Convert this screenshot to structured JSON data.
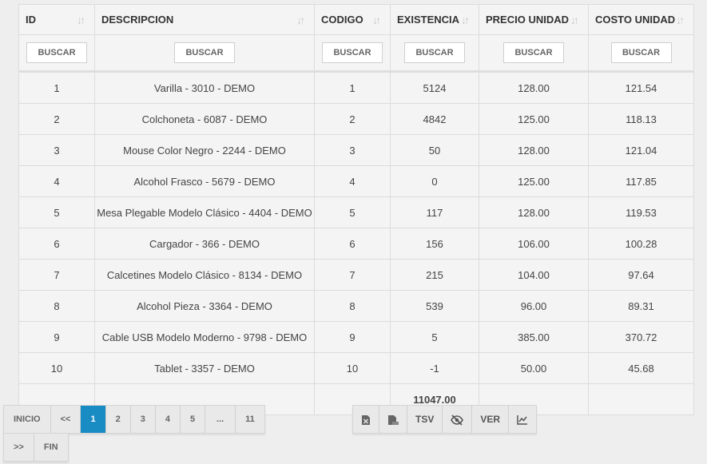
{
  "table": {
    "columns": [
      {
        "key": "id",
        "label": "ID",
        "search_placeholder": "BUSCAR"
      },
      {
        "key": "descripcion",
        "label": "DESCRIPCION",
        "search_placeholder": "BUSCAR"
      },
      {
        "key": "codigo",
        "label": "CODIGO",
        "search_placeholder": "BUSCAR"
      },
      {
        "key": "existencia",
        "label": "EXISTENCIA",
        "search_placeholder": "BUSCAR"
      },
      {
        "key": "precio",
        "label": "PRECIO UNIDAD",
        "search_placeholder": "BUSCAR"
      },
      {
        "key": "costo",
        "label": "COSTO UNIDAD",
        "search_placeholder": "BUSCAR"
      }
    ],
    "rows": [
      [
        "1",
        "Varilla - 3010 - DEMO",
        "1",
        "5124",
        "128.00",
        "121.54"
      ],
      [
        "2",
        "Colchoneta - 6087 - DEMO",
        "2",
        "4842",
        "125.00",
        "118.13"
      ],
      [
        "3",
        "Mouse Color Negro - 2244 - DEMO",
        "3",
        "50",
        "128.00",
        "121.04"
      ],
      [
        "4",
        "Alcohol Frasco - 5679 - DEMO",
        "4",
        "0",
        "125.00",
        "117.85"
      ],
      [
        "5",
        "Mesa Plegable Modelo Clásico - 4404 - DEMO",
        "5",
        "117",
        "128.00",
        "119.53"
      ],
      [
        "6",
        "Cargador - 366 - DEMO",
        "6",
        "156",
        "106.00",
        "100.28"
      ],
      [
        "7",
        "Calcetines Modelo Clásico - 8134 - DEMO",
        "7",
        "215",
        "104.00",
        "97.64"
      ],
      [
        "8",
        "Alcohol Pieza - 3364 - DEMO",
        "8",
        "539",
        "96.00",
        "89.31"
      ],
      [
        "9",
        "Cable USB Modelo Moderno - 9798 - DEMO",
        "9",
        "5",
        "385.00",
        "370.72"
      ],
      [
        "10",
        "Tablet - 3357 - DEMO",
        "10",
        "-1",
        "50.00",
        "45.68"
      ]
    ],
    "total_existencia": "11047.00"
  },
  "pagination": {
    "first": "INICIO",
    "prev": "<<",
    "pages": [
      "1",
      "2",
      "3",
      "4",
      "5"
    ],
    "active_page": "1",
    "ellipsis": "...",
    "last_page": "11",
    "next": ">>",
    "last": "FIN"
  },
  "toolbar": {
    "tsv_label": "TSV",
    "ver_label": "VER",
    "icons": [
      "excel-icon",
      "pdf-icon",
      "eye-slash-icon",
      "chart-icon"
    ]
  },
  "colors": {
    "accent": "#1a8cc4",
    "background": "#eeeeee"
  }
}
